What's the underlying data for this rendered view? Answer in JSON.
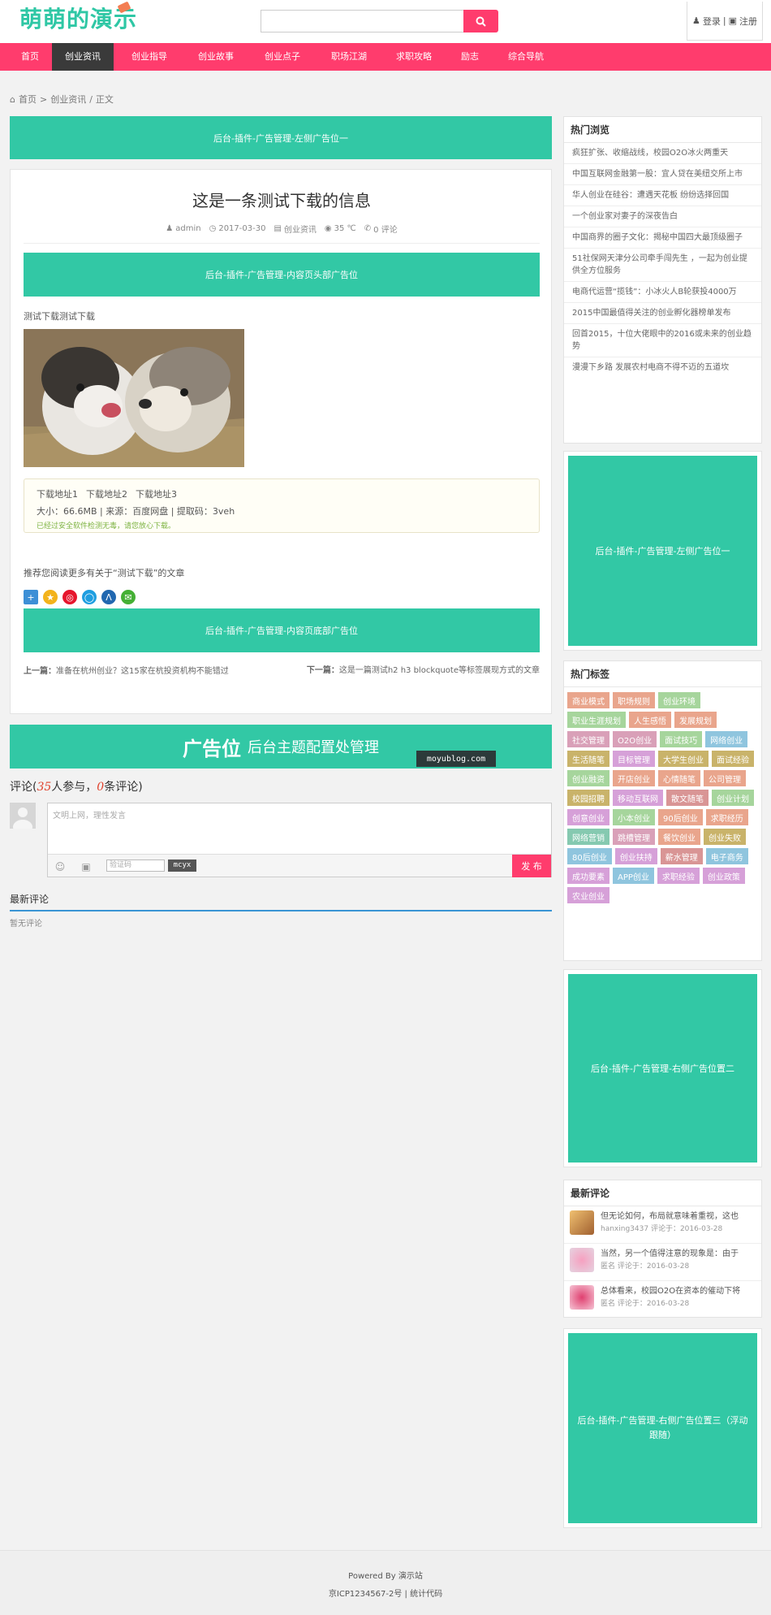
{
  "header": {
    "logo": "萌萌的演示",
    "search_placeholder": "",
    "login": "登录",
    "register": "注册",
    "user_sep": "|"
  },
  "nav": [
    {
      "label": "首页",
      "active": false
    },
    {
      "label": "创业资讯",
      "active": true
    },
    {
      "label": "创业指导",
      "active": false
    },
    {
      "label": "创业故事",
      "active": false
    },
    {
      "label": "创业点子",
      "active": false
    },
    {
      "label": "职场江湖",
      "active": false
    },
    {
      "label": "求职攻略",
      "active": false
    },
    {
      "label": "励志",
      "active": false
    },
    {
      "label": "综合导航",
      "active": false
    }
  ],
  "breadcrumb": {
    "home": "首页",
    "sep1": ">",
    "category": "创业资讯",
    "sep2": "/",
    "current": "正文"
  },
  "ads": {
    "top_left": "后台-插件-广告管理-左侧广告位一",
    "content_top": "后台-插件-广告管理-内容页头部广告位",
    "content_bottom": "后台-插件-广告管理-内容页底部广告位",
    "sidebar_1": "后台-插件-广告管理-左侧广告位一",
    "sidebar_2": "后台-插件-广告管理-右侧广告位置二",
    "sidebar_3": "后台-插件-广告管理-右侧广告位置三（浮动跟随）",
    "big_title": "广告位",
    "big_sub": "后台主题配置处管理",
    "watermark": "moyublog.com"
  },
  "post": {
    "title": "这是一条测试下载的信息",
    "author": "admin",
    "date": "2017-03-30",
    "category": "创业资讯",
    "views": "35 ℃",
    "comments": "0 评论",
    "body_text": "测试下载测试下载"
  },
  "download": {
    "links": [
      "下载地址1",
      "下载地址2",
      "下载地址3"
    ],
    "info": "大小：66.6MB | 来源：百度网盘 | 提取码：3veh",
    "safe": "已经过安全软件检测无毒，请您放心下载。"
  },
  "recommend": "推荐您阅读更多有关于“测试下载”的文章",
  "prev_label": "上一篇：",
  "prev_title": "准备在杭州创业？这15家在杭投资机构不能错过",
  "next_label": "下一篇：",
  "next_title": "这是一篇测试h2 h3 blockquote等标签展现方式的文章",
  "comment": {
    "title_pre": "评论(",
    "participants": "35",
    "title_mid": "人参与，",
    "count": "0",
    "title_post": "条评论)",
    "placeholder": "文明上网，理性发言",
    "captcha_placeholder": "验证码",
    "captcha_code": "mcyx",
    "submit": "发 布",
    "latest_heading": "最新评论",
    "none": "暂无评论"
  },
  "sidebar": {
    "hot_title": "热门浏览",
    "hot": [
      "疯狂扩张、收缩战线，校园O2O冰火两重天",
      "中国互联网金融第一股：宜人贷在美纽交所上市",
      "华人创业在硅谷：遭遇天花板 纷纷选择回国",
      "一个创业家对妻子的深夜告白",
      "中国商界的圈子文化：揭秘中国四大最顶级圈子",
      "51社保网天津分公司牵手闯先生 ，一起为创业提供全方位服务",
      "电商代运营“揽钱”：小冰火人B轮获投4000万",
      "2015中国最值得关注的创业孵化器榜单发布",
      "回首2015，十位大佬眼中的2016或未来的创业趋势",
      "漫漫下乡路 发展农村电商不得不迈的五道坎"
    ],
    "tags_title": "热门标签",
    "tags": [
      {
        "label": "商业模式",
        "color": "#e9a58c"
      },
      {
        "label": "职场规则",
        "color": "#e9a58c"
      },
      {
        "label": "创业环境",
        "color": "#a6d59c"
      },
      {
        "label": "职业生涯规划",
        "color": "#a6d59c"
      },
      {
        "label": "人生感悟",
        "color": "#e9a58c"
      },
      {
        "label": "发展规划",
        "color": "#e9a58c"
      },
      {
        "label": "社交管理",
        "color": "#d9a0b8"
      },
      {
        "label": "O2O创业",
        "color": "#d9a0b8"
      },
      {
        "label": "面试技巧",
        "color": "#a6d59c"
      },
      {
        "label": "网络创业",
        "color": "#8fc5de"
      },
      {
        "label": "生活随笔",
        "color": "#c9b36a"
      },
      {
        "label": "目标管理",
        "color": "#d6a0d8"
      },
      {
        "label": "大学生创业",
        "color": "#c9b36a"
      },
      {
        "label": "面试经验",
        "color": "#c9b36a"
      },
      {
        "label": "创业融资",
        "color": "#a6d59c"
      },
      {
        "label": "开店创业",
        "color": "#e9a58c"
      },
      {
        "label": "心情随笔",
        "color": "#e9a58c"
      },
      {
        "label": "公司管理",
        "color": "#e9a58c"
      },
      {
        "label": "校园招聘",
        "color": "#c9b36a"
      },
      {
        "label": "移动互联网",
        "color": "#d6a0d8"
      },
      {
        "label": "散文随笔",
        "color": "#d99595"
      },
      {
        "label": "创业计划",
        "color": "#a6d59c"
      },
      {
        "label": "创意创业",
        "color": "#d6a0d8"
      },
      {
        "label": "小本创业",
        "color": "#a6d59c"
      },
      {
        "label": "90后创业",
        "color": "#e9a58c"
      },
      {
        "label": "求职经历",
        "color": "#e9a58c"
      },
      {
        "label": "网络营销",
        "color": "#85c9b0"
      },
      {
        "label": "跳槽管理",
        "color": "#d9a0b8"
      },
      {
        "label": "餐饮创业",
        "color": "#e9a58c"
      },
      {
        "label": "创业失败",
        "color": "#c9b36a"
      },
      {
        "label": "80后创业",
        "color": "#8fc5de"
      },
      {
        "label": "创业扶持",
        "color": "#d6a0d8"
      },
      {
        "label": "薪水管理",
        "color": "#d99595"
      },
      {
        "label": "电子商务",
        "color": "#8fc5de"
      },
      {
        "label": "成功要素",
        "color": "#d6a0d8"
      },
      {
        "label": "APP创业",
        "color": "#8fc5de"
      },
      {
        "label": "求职经验",
        "color": "#d6a0d8"
      },
      {
        "label": "创业政策",
        "color": "#d6a0d8"
      },
      {
        "label": "农业创业",
        "color": "#d6a0d8"
      }
    ],
    "latest_title": "最新评论",
    "latest": [
      {
        "text": "但无论如何，布局就意味着重视，这也",
        "user": "hanxing3437",
        "date": "评论于：2016-03-28"
      },
      {
        "text": "当然，另一个值得注意的现象是：由于",
        "user": "匿名",
        "date": "评论于：2016-03-28"
      },
      {
        "text": "总体看来，校园O2O在资本的催动下将",
        "user": "匿名",
        "date": "评论于：2016-03-28"
      }
    ]
  },
  "footer": {
    "powered_pre": "Powered By",
    "powered_site": "演示站",
    "icp": "京ICP1234567-2号",
    "footer_sep": "|",
    "stats": "统计代码"
  },
  "colors": {
    "accent_pink": "#ff3c6d",
    "ad_green": "#32c8a5",
    "nav_active": "#3a3a3a",
    "logo_green": "#2fc7a5"
  }
}
